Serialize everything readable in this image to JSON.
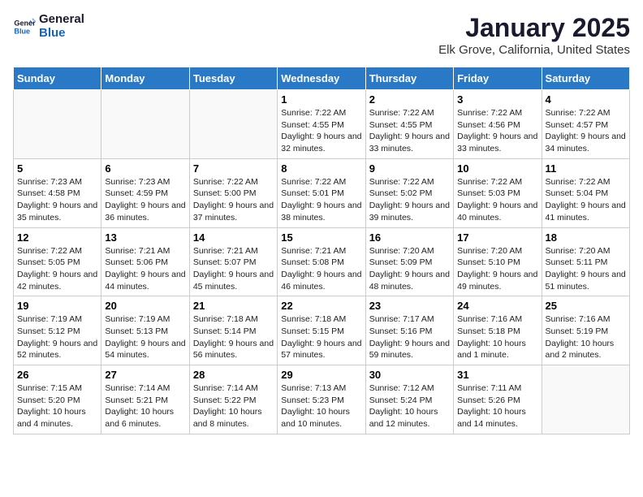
{
  "logo": {
    "line1": "General",
    "line2": "Blue"
  },
  "title": "January 2025",
  "subtitle": "Elk Grove, California, United States",
  "days_header": [
    "Sunday",
    "Monday",
    "Tuesday",
    "Wednesday",
    "Thursday",
    "Friday",
    "Saturday"
  ],
  "weeks": [
    [
      {
        "day": "",
        "info": ""
      },
      {
        "day": "",
        "info": ""
      },
      {
        "day": "",
        "info": ""
      },
      {
        "day": "1",
        "info": "Sunrise: 7:22 AM\nSunset: 4:55 PM\nDaylight: 9 hours and 32 minutes."
      },
      {
        "day": "2",
        "info": "Sunrise: 7:22 AM\nSunset: 4:55 PM\nDaylight: 9 hours and 33 minutes."
      },
      {
        "day": "3",
        "info": "Sunrise: 7:22 AM\nSunset: 4:56 PM\nDaylight: 9 hours and 33 minutes."
      },
      {
        "day": "4",
        "info": "Sunrise: 7:22 AM\nSunset: 4:57 PM\nDaylight: 9 hours and 34 minutes."
      }
    ],
    [
      {
        "day": "5",
        "info": "Sunrise: 7:23 AM\nSunset: 4:58 PM\nDaylight: 9 hours and 35 minutes."
      },
      {
        "day": "6",
        "info": "Sunrise: 7:23 AM\nSunset: 4:59 PM\nDaylight: 9 hours and 36 minutes."
      },
      {
        "day": "7",
        "info": "Sunrise: 7:22 AM\nSunset: 5:00 PM\nDaylight: 9 hours and 37 minutes."
      },
      {
        "day": "8",
        "info": "Sunrise: 7:22 AM\nSunset: 5:01 PM\nDaylight: 9 hours and 38 minutes."
      },
      {
        "day": "9",
        "info": "Sunrise: 7:22 AM\nSunset: 5:02 PM\nDaylight: 9 hours and 39 minutes."
      },
      {
        "day": "10",
        "info": "Sunrise: 7:22 AM\nSunset: 5:03 PM\nDaylight: 9 hours and 40 minutes."
      },
      {
        "day": "11",
        "info": "Sunrise: 7:22 AM\nSunset: 5:04 PM\nDaylight: 9 hours and 41 minutes."
      }
    ],
    [
      {
        "day": "12",
        "info": "Sunrise: 7:22 AM\nSunset: 5:05 PM\nDaylight: 9 hours and 42 minutes."
      },
      {
        "day": "13",
        "info": "Sunrise: 7:21 AM\nSunset: 5:06 PM\nDaylight: 9 hours and 44 minutes."
      },
      {
        "day": "14",
        "info": "Sunrise: 7:21 AM\nSunset: 5:07 PM\nDaylight: 9 hours and 45 minutes."
      },
      {
        "day": "15",
        "info": "Sunrise: 7:21 AM\nSunset: 5:08 PM\nDaylight: 9 hours and 46 minutes."
      },
      {
        "day": "16",
        "info": "Sunrise: 7:20 AM\nSunset: 5:09 PM\nDaylight: 9 hours and 48 minutes."
      },
      {
        "day": "17",
        "info": "Sunrise: 7:20 AM\nSunset: 5:10 PM\nDaylight: 9 hours and 49 minutes."
      },
      {
        "day": "18",
        "info": "Sunrise: 7:20 AM\nSunset: 5:11 PM\nDaylight: 9 hours and 51 minutes."
      }
    ],
    [
      {
        "day": "19",
        "info": "Sunrise: 7:19 AM\nSunset: 5:12 PM\nDaylight: 9 hours and 52 minutes."
      },
      {
        "day": "20",
        "info": "Sunrise: 7:19 AM\nSunset: 5:13 PM\nDaylight: 9 hours and 54 minutes."
      },
      {
        "day": "21",
        "info": "Sunrise: 7:18 AM\nSunset: 5:14 PM\nDaylight: 9 hours and 56 minutes."
      },
      {
        "day": "22",
        "info": "Sunrise: 7:18 AM\nSunset: 5:15 PM\nDaylight: 9 hours and 57 minutes."
      },
      {
        "day": "23",
        "info": "Sunrise: 7:17 AM\nSunset: 5:16 PM\nDaylight: 9 hours and 59 minutes."
      },
      {
        "day": "24",
        "info": "Sunrise: 7:16 AM\nSunset: 5:18 PM\nDaylight: 10 hours and 1 minute."
      },
      {
        "day": "25",
        "info": "Sunrise: 7:16 AM\nSunset: 5:19 PM\nDaylight: 10 hours and 2 minutes."
      }
    ],
    [
      {
        "day": "26",
        "info": "Sunrise: 7:15 AM\nSunset: 5:20 PM\nDaylight: 10 hours and 4 minutes."
      },
      {
        "day": "27",
        "info": "Sunrise: 7:14 AM\nSunset: 5:21 PM\nDaylight: 10 hours and 6 minutes."
      },
      {
        "day": "28",
        "info": "Sunrise: 7:14 AM\nSunset: 5:22 PM\nDaylight: 10 hours and 8 minutes."
      },
      {
        "day": "29",
        "info": "Sunrise: 7:13 AM\nSunset: 5:23 PM\nDaylight: 10 hours and 10 minutes."
      },
      {
        "day": "30",
        "info": "Sunrise: 7:12 AM\nSunset: 5:24 PM\nDaylight: 10 hours and 12 minutes."
      },
      {
        "day": "31",
        "info": "Sunrise: 7:11 AM\nSunset: 5:26 PM\nDaylight: 10 hours and 14 minutes."
      },
      {
        "day": "",
        "info": ""
      }
    ]
  ]
}
